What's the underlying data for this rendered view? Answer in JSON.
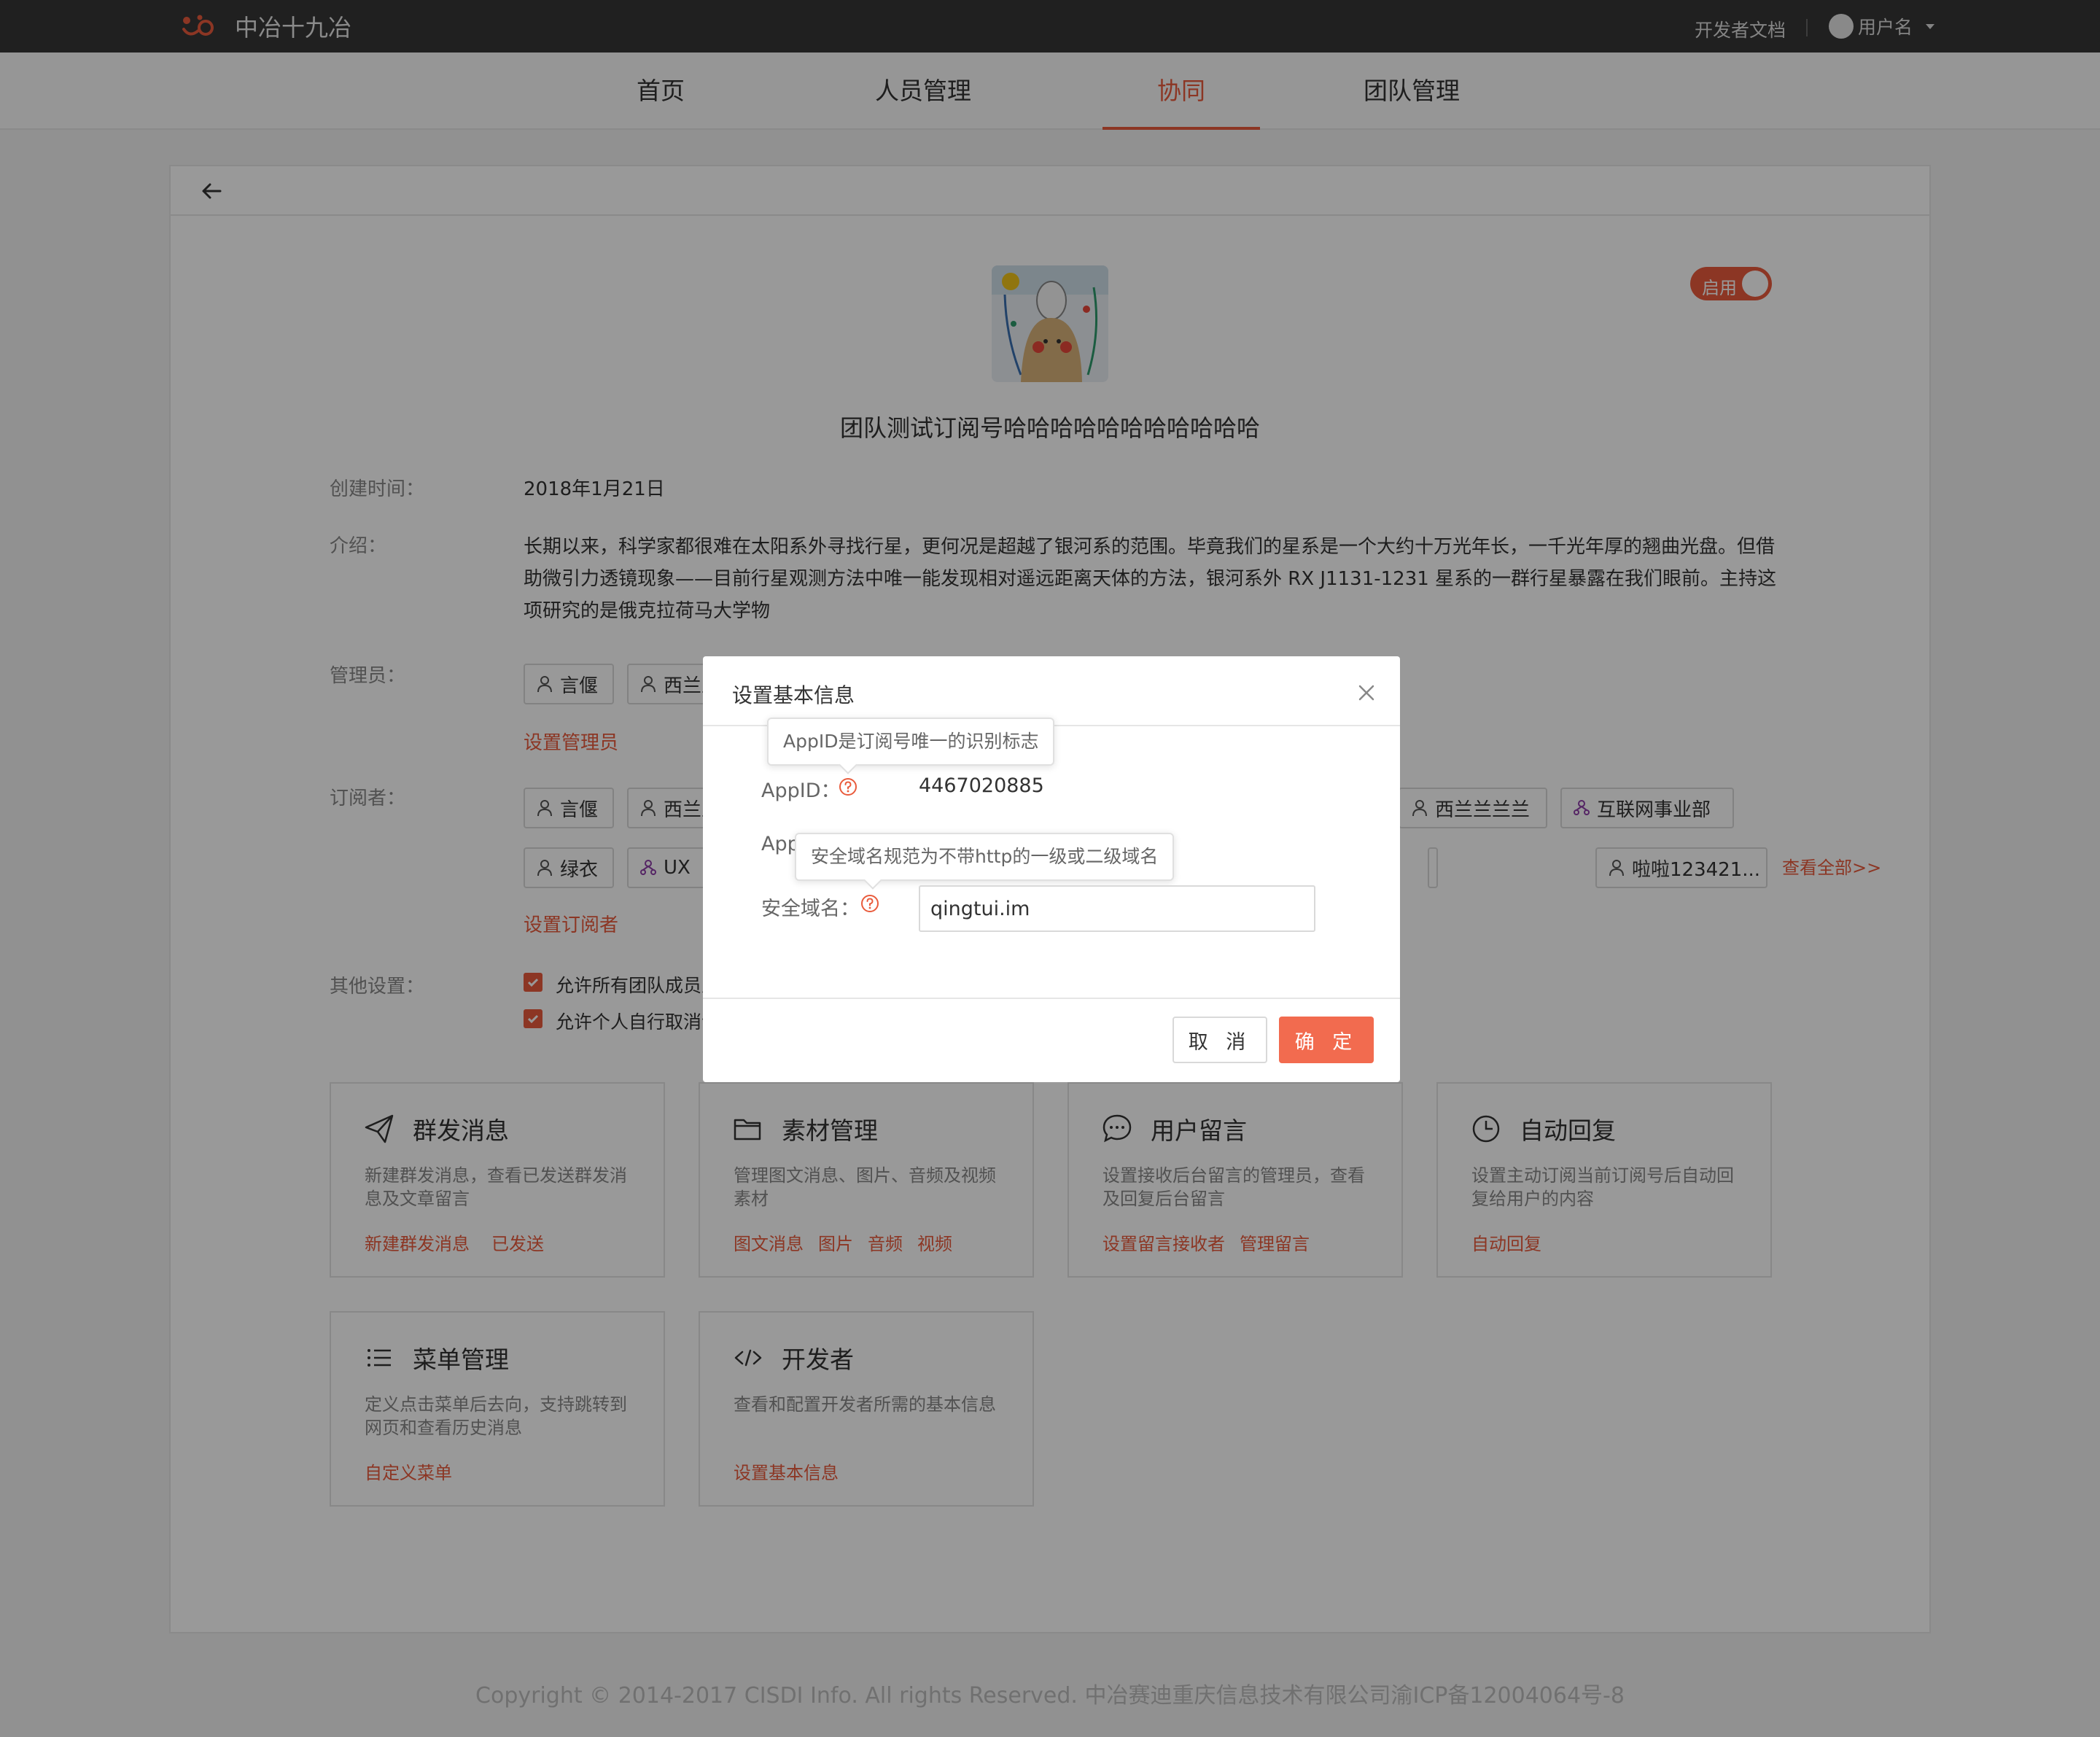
{
  "brand": {
    "name": "中冶十九冶"
  },
  "topbar": {
    "dev_docs": "开发者文档",
    "username": "用户名"
  },
  "nav": {
    "tabs": [
      {
        "label": "首页"
      },
      {
        "label": "人员管理"
      },
      {
        "label": "协同",
        "active": true
      },
      {
        "label": "团队管理"
      }
    ]
  },
  "account": {
    "status_label": "启用",
    "title": "团队测试订阅号哈哈哈哈哈哈哈哈哈哈哈",
    "created_label": "创建时间：",
    "created_value": "2018年1月21日",
    "intro_label": "介绍：",
    "intro_text": "长期以来，科学家都很难在太阳系外寻找行星，更何况是超越了银河系的范围。毕竟我们的星系是一个大约十万光年长，一千光年厚的翘曲光盘。但借助微引力透镜现象——目前行星观测方法中唯一能发现相对遥远距离天体的方法，银河系外 RX J1131-1231 星系的一群行星暴露在我们眼前。主持这项研究的是俄克拉荷马大学物",
    "admins_label": "管理员：",
    "admins": [
      "言偃",
      "西兰兰兰兰"
    ],
    "set_admins": "设置管理员",
    "subscribers_label": "订阅者：",
    "subscribers_row1": [
      "言偃",
      "西兰兰兰兰",
      "西兰兰兰兰",
      "互联网事业部"
    ],
    "subscribers_row2": [
      "绿衣",
      "UX",
      "啦啦123421..."
    ],
    "view_all": "查看全部>>",
    "set_subscribers": "设置订阅者",
    "other_label": "其他设置：",
    "options": [
      "允许所有团队成员从",
      "允许个人自行取消订阅"
    ]
  },
  "features": [
    {
      "icon": "send-icon",
      "title": "群发消息",
      "desc": "新建群发消息，查看已发送群发消息及文章留言",
      "links": [
        "新建群发消息",
        "已发送"
      ]
    },
    {
      "icon": "folder-icon",
      "title": "素材管理",
      "desc": "管理图文消息、图片、音频及视频素材",
      "links": [
        "图文消息",
        "图片",
        "音频",
        "视频"
      ]
    },
    {
      "icon": "comment-icon",
      "title": "用户留言",
      "desc": "设置接收后台留言的管理员，查看及回复后台留言",
      "links": [
        "设置留言接收者",
        "管理留言"
      ]
    },
    {
      "icon": "clock-icon",
      "title": "自动回复",
      "desc": "设置主动订阅当前订阅号后自动回复给用户的内容",
      "links": [
        "自动回复"
      ]
    },
    {
      "icon": "list-icon",
      "title": "菜单管理",
      "desc": "定义点击菜单后去向，支持跳转到网页和查看历史消息",
      "links": [
        "自定义菜单"
      ]
    },
    {
      "icon": "code-icon",
      "title": "开发者",
      "desc": "查看和配置开发者所需的基本信息",
      "links": [
        "设置基本信息"
      ]
    }
  ],
  "footer": {
    "text": "Copyright © 2014-2017 CISDI Info. All rights Reserved. 中冶赛迪重庆信息技术有限公司渝ICP备12004064号-8"
  },
  "modal": {
    "title": "设置基本信息",
    "appid_tooltip": "AppID是订阅号唯一的识别标志",
    "appid_label": "AppID：",
    "appid_value": "4467020885",
    "secret_label": "App",
    "domain_tooltip": "安全域名规范为不带http的一级或二级域名",
    "domain_label": "安全域名：",
    "domain_value": "qingtui.im",
    "cancel": "取 消",
    "confirm": "确 定"
  },
  "colors": {
    "accent": "#e95b3c",
    "topbar": "#363636",
    "confirm_button": "#f26b4f"
  }
}
